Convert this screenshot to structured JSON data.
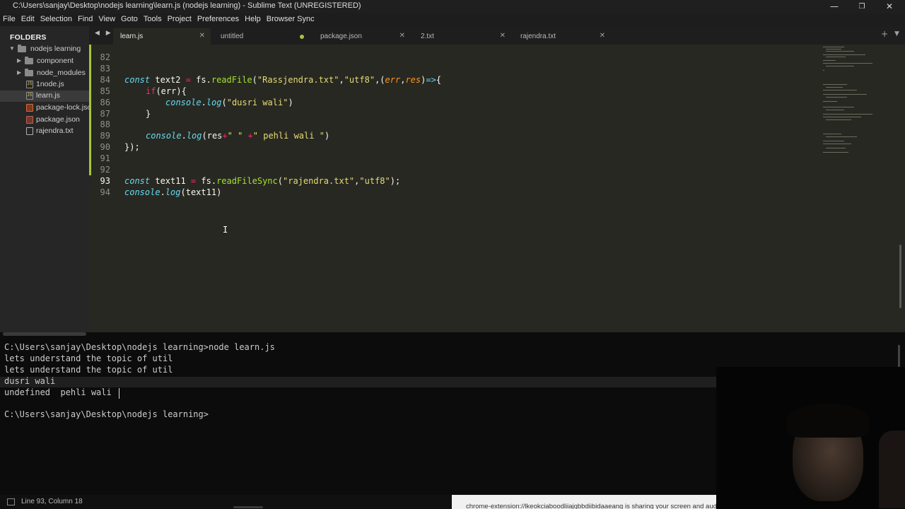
{
  "window": {
    "title": "C:\\Users\\sanjay\\Desktop\\nodejs learning\\learn.js (nodejs learning) - Sublime Text (UNREGISTERED)",
    "minimize": "—",
    "maximize": "❐",
    "close": "✕"
  },
  "menu": [
    "File",
    "Edit",
    "Selection",
    "Find",
    "View",
    "Goto",
    "Tools",
    "Project",
    "Preferences",
    "Help",
    "Browser Sync"
  ],
  "sidebar": {
    "header": "FOLDERS",
    "items": [
      {
        "label": "nodejs learning",
        "kind": "folder-open",
        "depth": 0
      },
      {
        "label": "component",
        "kind": "folder",
        "depth": 1
      },
      {
        "label": "node_modules",
        "kind": "folder",
        "depth": 1
      },
      {
        "label": "1node.js",
        "kind": "js",
        "depth": 1
      },
      {
        "label": "learn.js",
        "kind": "js",
        "depth": 1,
        "selected": true
      },
      {
        "label": "package-lock.json",
        "kind": "lock",
        "depth": 1
      },
      {
        "label": "package.json",
        "kind": "json",
        "depth": 1
      },
      {
        "label": "rajendra.txt",
        "kind": "txt",
        "depth": 1
      }
    ]
  },
  "tabs": [
    {
      "label": "learn.js",
      "active": true,
      "close": "✕"
    },
    {
      "label": "untitled",
      "dirty": true
    },
    {
      "label": "package.json",
      "close": "✕"
    },
    {
      "label": "2.txt",
      "close": "✕"
    },
    {
      "label": "rajendra.txt",
      "close": "✕"
    }
  ],
  "tabbar": {
    "nav": "◀ ▶",
    "plus": "+",
    "dropdown": "▼"
  },
  "editor": {
    "partial_line_number": "82",
    "line_numbers": [
      "83",
      "84",
      "85",
      "86",
      "87",
      "88",
      "89",
      "90",
      "91",
      "92",
      "93",
      "94"
    ],
    "current_line": "93",
    "code": {
      "l83": {
        "const": "const",
        "name": " text2 ",
        "eq": "=",
        "obj": " fs.",
        "fn": "readFile",
        "open": "(",
        "s1": "\"Rassjendra.txt\"",
        "comma1": ",",
        "s2": "\"utf8\"",
        "comma2": ",(",
        "a1": "err",
        "comma3": ",",
        "a2": "res",
        "close": ")",
        "arrow": "=>",
        "brace": "{"
      },
      "l84": {
        "kw": "if",
        "rest": "(err){"
      },
      "l85": {
        "mod": "console",
        "dot": ".",
        "fn": "log",
        "open": "(",
        "str": "\"dusri wali\"",
        "close": ")"
      },
      "l86": {
        "text": "}"
      },
      "l88": {
        "mod": "console",
        "dot": ".",
        "fn": "log",
        "open": "(res",
        "plus1": "+",
        "str1": "\" \"",
        "plus2": " +",
        "str2": "\" pehli wali \"",
        "close": ")"
      },
      "l89": {
        "text": "});"
      },
      "l92": {
        "const": "const",
        "name": " text11 ",
        "eq": "=",
        "obj": " fs.",
        "fn": "readFileSync",
        "open": "(",
        "s1": "\"rajendra.txt\"",
        "comma": ",",
        "s2": "\"utf8\"",
        "close": ");"
      },
      "l93": {
        "mod": "console",
        "dot": ".",
        "fn": "log",
        "rest": "(text11)"
      }
    },
    "mouse_cursor": "I"
  },
  "terminal": {
    "lines": [
      "C:\\Users\\sanjay\\Desktop\\nodejs learning>node learn.js",
      "lets understand the topic of util",
      "lets understand the topic of util",
      "dusri wali",
      "undefined  pehli wali ",
      "",
      "C:\\Users\\sanjay\\Desktop\\nodejs learning>"
    ]
  },
  "share_banner": "chrome-extension://lkeokciaboodliiajqbbdiibidaaeang is sharing your screen and audio.",
  "status": {
    "text": "Line 93, Column 18"
  }
}
